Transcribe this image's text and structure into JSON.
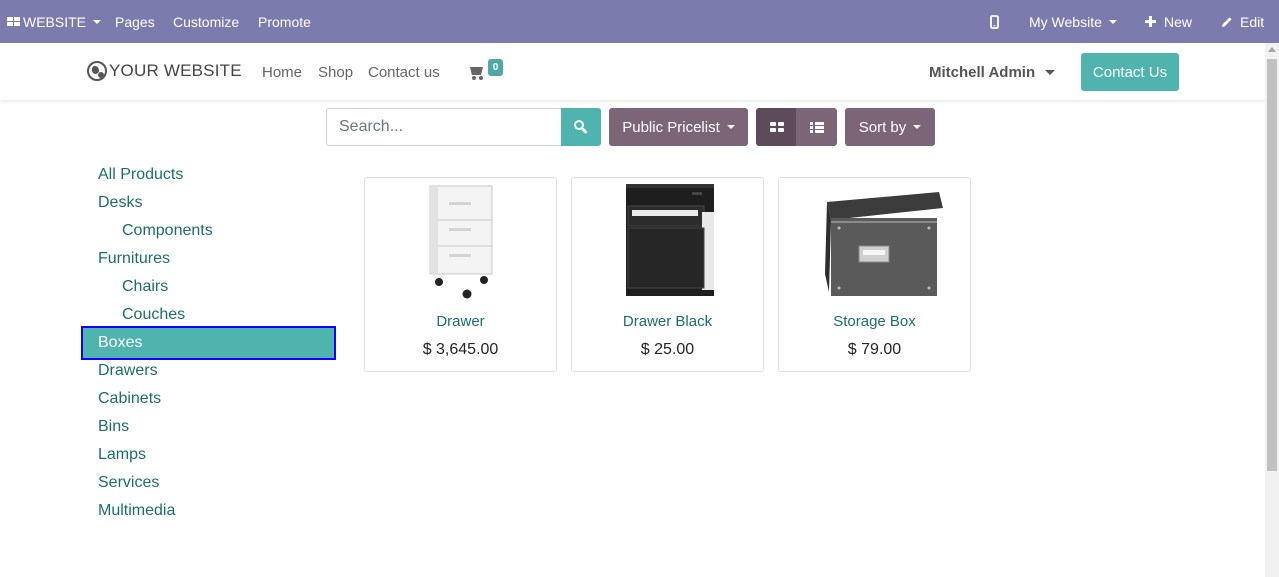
{
  "admin_bar": {
    "website_menu": "WEBSITE",
    "pages": "Pages",
    "customize": "Customize",
    "promote": "Promote",
    "my_website": "My Website",
    "new": "New",
    "edit": "Edit"
  },
  "header": {
    "logo": "YOUR WEBSITE",
    "nav": [
      "Home",
      "Shop",
      "Contact us"
    ],
    "cart_count": "0",
    "user": "Mitchell Admin",
    "contact_button": "Contact Us"
  },
  "toolbar": {
    "search_placeholder": "Search...",
    "pricelist": "Public Pricelist",
    "sort": "Sort by"
  },
  "categories": [
    {
      "label": "All Products",
      "level": 0,
      "active": false
    },
    {
      "label": "Desks",
      "level": 0,
      "active": false
    },
    {
      "label": "Components",
      "level": 1,
      "active": false
    },
    {
      "label": "Furnitures",
      "level": 0,
      "active": false
    },
    {
      "label": "Chairs",
      "level": 1,
      "active": false
    },
    {
      "label": "Couches",
      "level": 1,
      "active": false
    },
    {
      "label": "Boxes",
      "level": 0,
      "active": true
    },
    {
      "label": "Drawers",
      "level": 0,
      "active": false
    },
    {
      "label": "Cabinets",
      "level": 0,
      "active": false
    },
    {
      "label": "Bins",
      "level": 0,
      "active": false
    },
    {
      "label": "Lamps",
      "level": 0,
      "active": false
    },
    {
      "label": "Services",
      "level": 0,
      "active": false
    },
    {
      "label": "Multimedia",
      "level": 0,
      "active": false
    }
  ],
  "products": [
    {
      "name": "Drawer",
      "price": "$ 3,645.00"
    },
    {
      "name": "Drawer Black",
      "price": "$ 25.00"
    },
    {
      "name": "Storage Box",
      "price": "$ 79.00"
    }
  ],
  "colors": {
    "admin_bar": "#7c7bad",
    "accent": "#4fb3ae",
    "link": "#1b6f6b",
    "secondary": "#7c6577",
    "active_outline": "#1500ff"
  }
}
